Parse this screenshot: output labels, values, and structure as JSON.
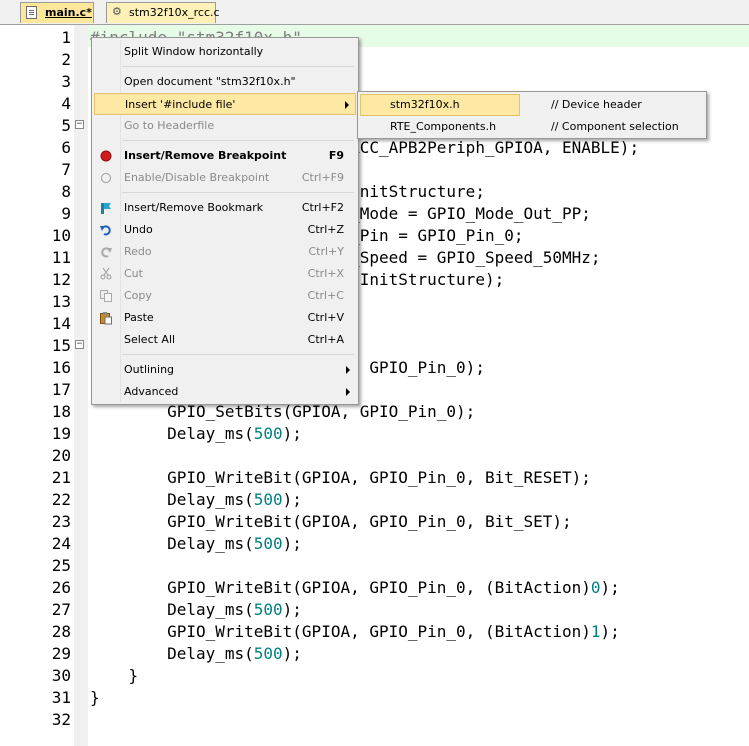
{
  "tabs": [
    {
      "label": "main.c*",
      "active": true
    },
    {
      "label": "stm32f10x_rcc.c",
      "active": false
    }
  ],
  "editor": {
    "lines": [
      {
        "n": "1",
        "code": "#include \"stm32f10x.h\"",
        "cls": "pp"
      },
      {
        "n": "2",
        "code": ""
      },
      {
        "n": "3",
        "code": ""
      },
      {
        "n": "4",
        "code": ""
      },
      {
        "n": "5",
        "code": "",
        "fold": "-"
      },
      {
        "n": "6",
        "code": "                           RCC_APB2Periph_GPIOA, ENABLE);"
      },
      {
        "n": "7",
        "code": ""
      },
      {
        "n": "8",
        "code": "                            nitStructure;"
      },
      {
        "n": "9",
        "code": "                           _Mode = GPIO_Mode_Out_PP;"
      },
      {
        "n": "10",
        "code": "                           _Pin = GPIO_Pin_0;"
      },
      {
        "n": "11",
        "code": "                           _Speed = GPIO_Speed_50MHz;"
      },
      {
        "n": "12",
        "code": "                            InitStructure);"
      },
      {
        "n": "13",
        "code": ""
      },
      {
        "n": "14",
        "code": ""
      },
      {
        "n": "15",
        "code": "",
        "fold": "-"
      },
      {
        "n": "16",
        "code": "                          A, GPIO_Pin_0);"
      },
      {
        "n": "17",
        "code": ""
      },
      {
        "n": "18",
        "code": "        GPIO_SetBits(GPIOA, GPIO_Pin_0);"
      },
      {
        "n": "19",
        "code": "        Delay_ms(500);",
        "numv": "500"
      },
      {
        "n": "20",
        "code": ""
      },
      {
        "n": "21",
        "code": "        GPIO_WriteBit(GPIOA, GPIO_Pin_0, Bit_RESET);"
      },
      {
        "n": "22",
        "code": "        Delay_ms(500);",
        "numv": "500"
      },
      {
        "n": "23",
        "code": "        GPIO_WriteBit(GPIOA, GPIO_Pin_0, Bit_SET);"
      },
      {
        "n": "24",
        "code": "        Delay_ms(500);",
        "numv": "500"
      },
      {
        "n": "25",
        "code": ""
      },
      {
        "n": "26",
        "code": "        GPIO_WriteBit(GPIOA, GPIO_Pin_0, (BitAction)0);",
        "numv": "0"
      },
      {
        "n": "27",
        "code": "        Delay_ms(500);",
        "numv": "500"
      },
      {
        "n": "28",
        "code": "        GPIO_WriteBit(GPIOA, GPIO_Pin_0, (BitAction)1);",
        "numv": "1"
      },
      {
        "n": "29",
        "code": "        Delay_ms(500);",
        "numv": "500"
      },
      {
        "n": "30",
        "code": "    }"
      },
      {
        "n": "31",
        "code": "}"
      },
      {
        "n": "32",
        "code": ""
      }
    ]
  },
  "context_menu": {
    "items": [
      {
        "label": "Split Window horizontally",
        "shortcut": ""
      },
      {
        "sep": true
      },
      {
        "label": "Open document \"stm32f10x.h\"",
        "shortcut": ""
      },
      {
        "label": "Insert '#include file'",
        "shortcut": "",
        "submenu": true,
        "hover": true
      },
      {
        "label": "Go to Headerfile",
        "shortcut": "",
        "disabled": true
      },
      {
        "sep": true
      },
      {
        "label": "Insert/Remove Breakpoint",
        "shortcut": "F9",
        "bold": true,
        "icon": "breakpoint-icon"
      },
      {
        "label": "Enable/Disable Breakpoint",
        "shortcut": "Ctrl+F9",
        "disabled": true,
        "icon": "disabled-breakpoint-icon"
      },
      {
        "sep": true
      },
      {
        "label": "Insert/Remove Bookmark",
        "shortcut": "Ctrl+F2",
        "icon": "bookmark-icon"
      },
      {
        "label": "Undo",
        "shortcut": "Ctrl+Z",
        "icon": "undo-icon"
      },
      {
        "label": "Redo",
        "shortcut": "Ctrl+Y",
        "disabled": true,
        "icon": "redo-icon"
      },
      {
        "label": "Cut",
        "shortcut": "Ctrl+X",
        "disabled": true,
        "icon": "cut-icon"
      },
      {
        "label": "Copy",
        "shortcut": "Ctrl+C",
        "disabled": true,
        "icon": "copy-icon"
      },
      {
        "label": "Paste",
        "shortcut": "Ctrl+V",
        "icon": "paste-icon"
      },
      {
        "label": "Select All",
        "shortcut": "Ctrl+A"
      },
      {
        "sep": true
      },
      {
        "label": "Outlining",
        "shortcut": "",
        "submenu": true
      },
      {
        "label": "Advanced",
        "shortcut": "",
        "submenu": true
      }
    ]
  },
  "submenu": {
    "items": [
      {
        "file": "stm32f10x.h",
        "desc": "// Device header",
        "hover": true
      },
      {
        "file": "RTE_Components.h",
        "desc": "// Component selection"
      }
    ]
  },
  "colors": {
    "current_line": "#e6fce6",
    "menu_hover": "#fde9a4",
    "tab_active": "#fde79b",
    "preprocessor": "#7e7e7e",
    "number_literal": "#008080"
  }
}
